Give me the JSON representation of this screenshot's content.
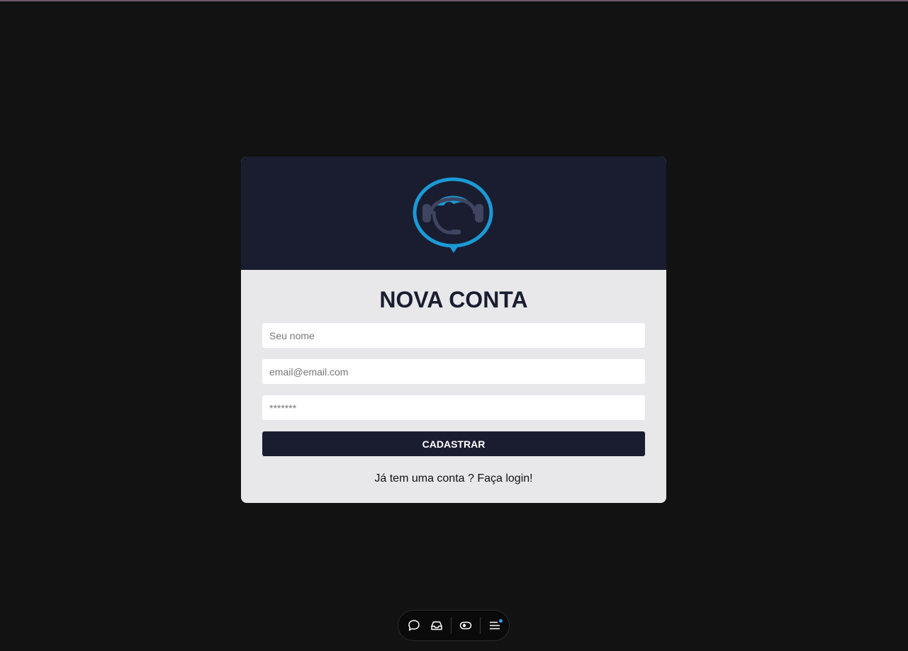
{
  "form": {
    "title": "NOVA CONTA",
    "name_placeholder": "Seu nome",
    "email_placeholder": "email@email.com",
    "password_placeholder": "*******",
    "submit_label": "CADASTRAR",
    "login_link": "Já tem uma conta ? Faça login!"
  },
  "logo": {
    "icon": "headset-chat-bubble-icon"
  },
  "toolbar": {
    "items": [
      {
        "icon": "chat-bubble-icon"
      },
      {
        "icon": "inbox-icon"
      },
      {
        "icon": "toggle-icon"
      },
      {
        "icon": "menu-icon"
      }
    ]
  },
  "colors": {
    "page_background": "#121212",
    "header_background": "#1a1d30",
    "card_body": "#e8e8ea",
    "accent": "#1a9ad6"
  }
}
